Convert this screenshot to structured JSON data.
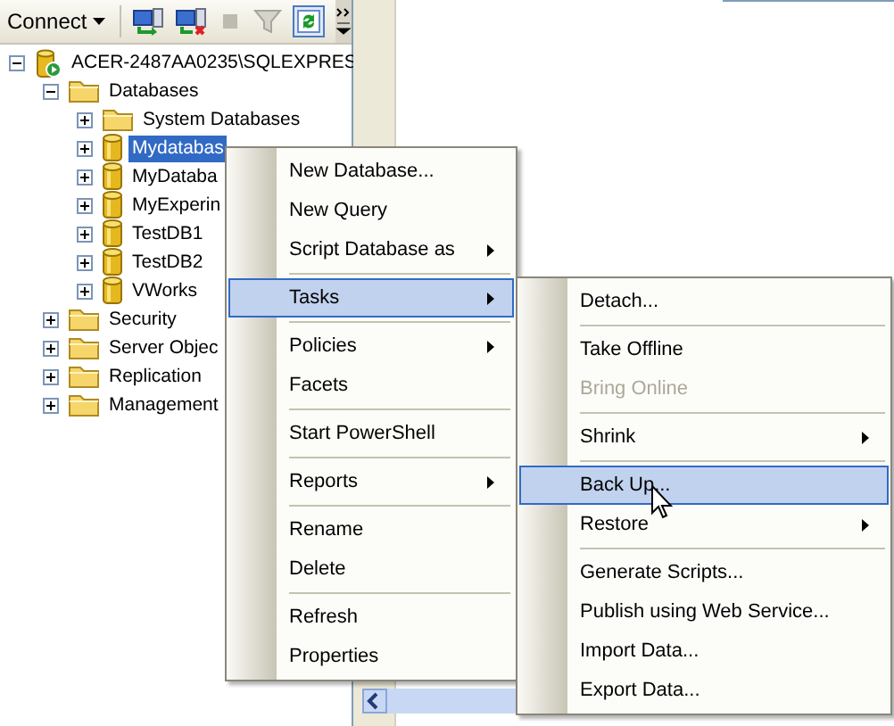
{
  "toolbar": {
    "connect_label": "Connect"
  },
  "tree": [
    {
      "kind": "server",
      "label": "ACER-2487AA0235\\SQLEXPRES",
      "expanded": true,
      "selected": false,
      "children": [
        {
          "kind": "folder",
          "label": "Databases",
          "expanded": true,
          "selected": false,
          "children": [
            {
              "kind": "folder",
              "label": "System Databases",
              "expanded": false,
              "selected": false
            },
            {
              "kind": "database",
              "label": "Mydatabas",
              "expanded": false,
              "selected": true
            },
            {
              "kind": "database",
              "label": "MyDataba",
              "expanded": false,
              "selected": false
            },
            {
              "kind": "database",
              "label": "MyExperin",
              "expanded": false,
              "selected": false
            },
            {
              "kind": "database",
              "label": "TestDB1",
              "expanded": false,
              "selected": false
            },
            {
              "kind": "database",
              "label": "TestDB2",
              "expanded": false,
              "selected": false
            },
            {
              "kind": "database",
              "label": "VWorks",
              "expanded": false,
              "selected": false
            }
          ]
        },
        {
          "kind": "folder",
          "label": "Security",
          "expanded": false,
          "selected": false
        },
        {
          "kind": "folder",
          "label": "Server Objec",
          "expanded": false,
          "selected": false
        },
        {
          "kind": "folder",
          "label": "Replication",
          "expanded": false,
          "selected": false
        },
        {
          "kind": "folder",
          "label": "Management",
          "expanded": false,
          "selected": false
        }
      ]
    }
  ],
  "context_menu": [
    {
      "kind": "item",
      "label": "New Database...",
      "submenu": false,
      "selected": false,
      "disabled": false
    },
    {
      "kind": "item",
      "label": "New Query",
      "submenu": false,
      "selected": false,
      "disabled": false
    },
    {
      "kind": "item",
      "label": "Script Database as",
      "submenu": true,
      "selected": false,
      "disabled": false
    },
    {
      "kind": "separator"
    },
    {
      "kind": "item",
      "label": "Tasks",
      "submenu": true,
      "selected": true,
      "disabled": false
    },
    {
      "kind": "separator"
    },
    {
      "kind": "item",
      "label": "Policies",
      "submenu": true,
      "selected": false,
      "disabled": false
    },
    {
      "kind": "item",
      "label": "Facets",
      "submenu": false,
      "selected": false,
      "disabled": false
    },
    {
      "kind": "separator"
    },
    {
      "kind": "item",
      "label": "Start PowerShell",
      "submenu": false,
      "selected": false,
      "disabled": false
    },
    {
      "kind": "separator"
    },
    {
      "kind": "item",
      "label": "Reports",
      "submenu": true,
      "selected": false,
      "disabled": false
    },
    {
      "kind": "separator"
    },
    {
      "kind": "item",
      "label": "Rename",
      "submenu": false,
      "selected": false,
      "disabled": false
    },
    {
      "kind": "item",
      "label": "Delete",
      "submenu": false,
      "selected": false,
      "disabled": false
    },
    {
      "kind": "separator"
    },
    {
      "kind": "item",
      "label": "Refresh",
      "submenu": false,
      "selected": false,
      "disabled": false
    },
    {
      "kind": "item",
      "label": "Properties",
      "submenu": false,
      "selected": false,
      "disabled": false
    }
  ],
  "tasks_submenu": [
    {
      "kind": "item",
      "label": "Detach...",
      "submenu": false,
      "selected": false,
      "disabled": false
    },
    {
      "kind": "separator"
    },
    {
      "kind": "item",
      "label": "Take Offline",
      "submenu": false,
      "selected": false,
      "disabled": false
    },
    {
      "kind": "item",
      "label": "Bring Online",
      "submenu": false,
      "selected": false,
      "disabled": true
    },
    {
      "kind": "separator"
    },
    {
      "kind": "item",
      "label": "Shrink",
      "submenu": true,
      "selected": false,
      "disabled": false
    },
    {
      "kind": "separator"
    },
    {
      "kind": "item",
      "label": "Back Up...",
      "submenu": false,
      "selected": true,
      "disabled": false
    },
    {
      "kind": "item",
      "label": "Restore",
      "submenu": true,
      "selected": false,
      "disabled": false
    },
    {
      "kind": "separator"
    },
    {
      "kind": "item",
      "label": "Generate Scripts...",
      "submenu": false,
      "selected": false,
      "disabled": false
    },
    {
      "kind": "item",
      "label": "Publish using Web Service...",
      "submenu": false,
      "selected": false,
      "disabled": false
    },
    {
      "kind": "item",
      "label": "Import Data...",
      "submenu": false,
      "selected": false,
      "disabled": false
    },
    {
      "kind": "item",
      "label": "Export Data...",
      "submenu": false,
      "selected": false,
      "disabled": false
    }
  ]
}
